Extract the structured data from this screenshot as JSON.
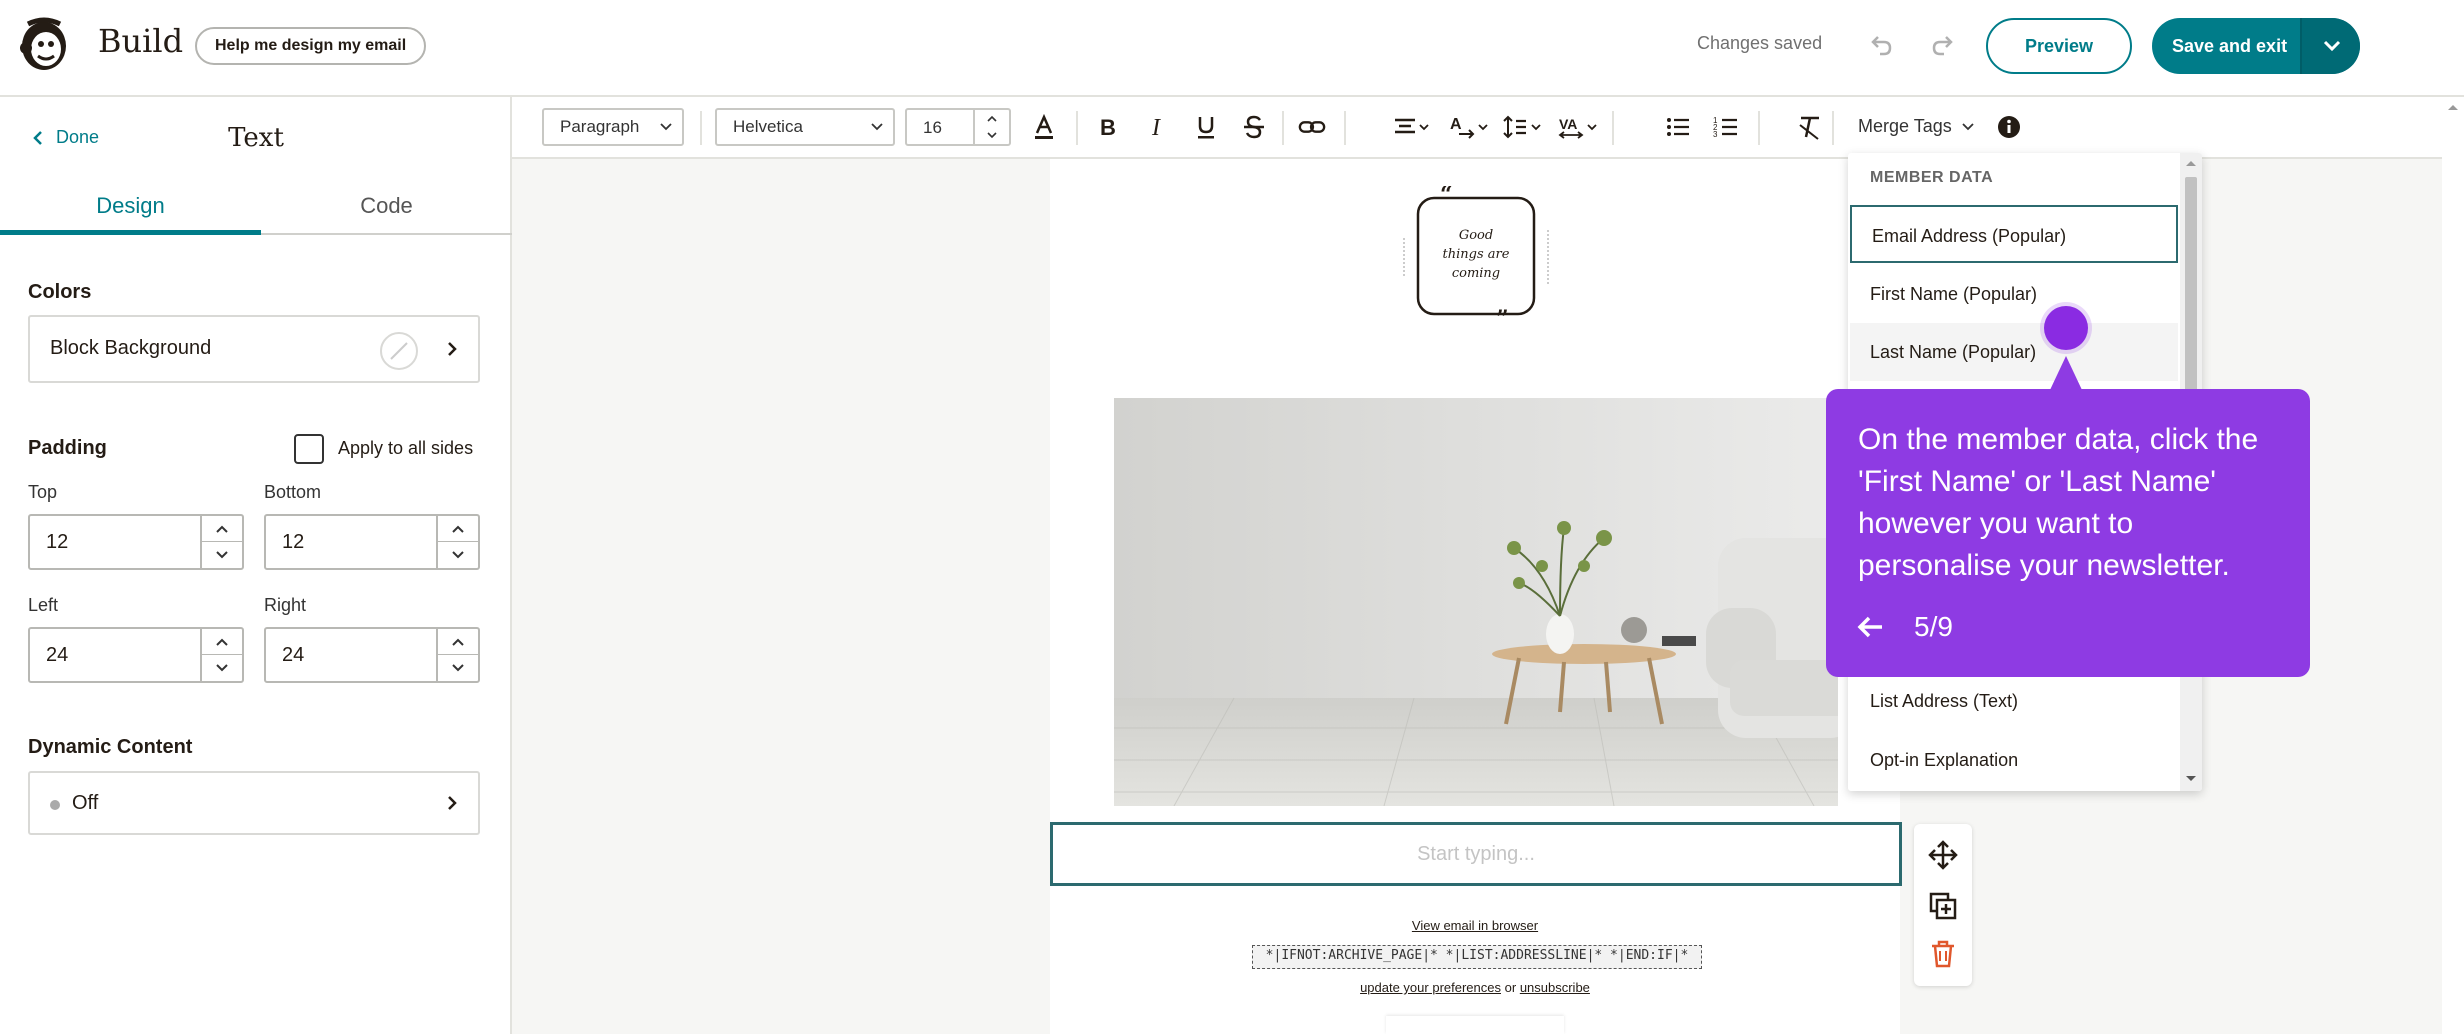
{
  "topbar": {
    "title": "Build",
    "help_button": "Help me design my email",
    "status": "Changes saved",
    "preview": "Preview",
    "save_exit": "Save and exit"
  },
  "left_panel": {
    "done": "Done",
    "title": "Text",
    "tabs": [
      "Design",
      "Code"
    ],
    "colors": {
      "label": "Colors",
      "block_background": "Block Background"
    },
    "padding": {
      "label": "Padding",
      "apply_all": "Apply to all sides",
      "top": {
        "label": "Top",
        "value": "12"
      },
      "bottom": {
        "label": "Bottom",
        "value": "12"
      },
      "left": {
        "label": "Left",
        "value": "24"
      },
      "right": {
        "label": "Right",
        "value": "24"
      }
    },
    "dynamic_content": {
      "label": "Dynamic Content",
      "value": "Off"
    }
  },
  "toolbar": {
    "paragraph": "Paragraph",
    "font": "Helvetica",
    "size": "16",
    "merge_tags": "Merge Tags"
  },
  "dropdown": {
    "heading": "MEMBER DATA",
    "items": [
      "Email Address (Popular)",
      "First Name (Popular)",
      "Last Name (Popular)",
      "List Address (Text)",
      "Opt-in Explanation"
    ]
  },
  "email": {
    "logo_text": "Good things are coming",
    "placeholder": "Start typing...",
    "view_browser": "View email in browser",
    "merge_code": "*|IFNOT:ARCHIVE_PAGE|* *|LIST:ADDRESSLINE|* *|END:IF|*",
    "update_prefs": "update your preferences",
    "or": "or",
    "unsubscribe": "unsubscribe"
  },
  "tooltip": {
    "text": "On the member data, click the 'First Name' or 'Last Name' however you want to personalise your newsletter.",
    "step": "5/9"
  },
  "colors": {
    "accent": "#007c89",
    "tooltip": "#8e3be3"
  }
}
